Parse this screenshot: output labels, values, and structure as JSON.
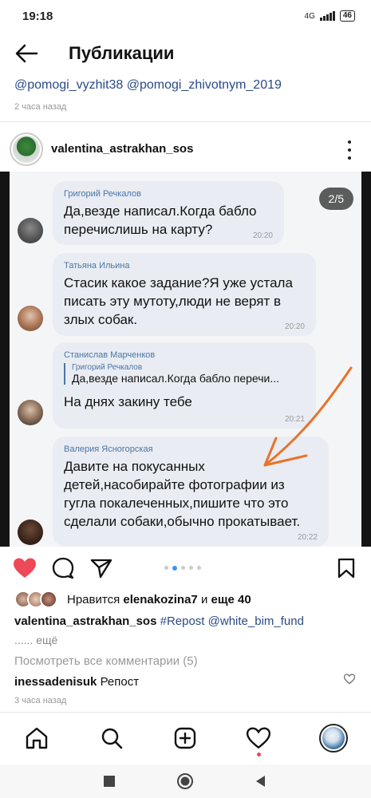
{
  "status_bar": {
    "time": "19:18",
    "network": "4G",
    "battery": "46"
  },
  "header": {
    "title": "Публикации"
  },
  "repost": {
    "tags": "@pomogi_vyzhit38 @pomogi_zhivotnym_2019",
    "time": "2 часа назад"
  },
  "post": {
    "username": "valentina_astrakhan_sos",
    "counter": "2/5",
    "messages": [
      {
        "author": "Григорий Речкалов",
        "text": "Да,везде написал.Когда бабло перечислишь на карту?",
        "time": "20:20"
      },
      {
        "author": "Татьяна Ильина",
        "text": "Стасик какое задание?Я уже устала писать эту мутоту,люди не верят в злых собак.",
        "time": "20:20"
      },
      {
        "author": "Станислав Марченков",
        "quote_author": "Григорий Речкалов",
        "quote_text": "Да,везде написал.Когда бабло перечи...",
        "text": "На днях закину тебе",
        "time": "20:21"
      },
      {
        "author": "Валерия Ясногорская",
        "text": "Давите на покусанных детей,насобирайте фотографии из гугла покалеченных,пишите что это сделали собаки,обычно прокатывает.",
        "time": "20:22"
      }
    ]
  },
  "likes": {
    "prefix": "Нравится",
    "user": "elenakozina7",
    "joiner": "и",
    "rest": "еще 40"
  },
  "caption": {
    "username": "valentina_astrakhan_sos",
    "text": "#Repost @white_bim_fund",
    "more": "...... ещё"
  },
  "view_comments": "Посмотреть все комментарии (5)",
  "comment": {
    "username": "inessadenisuk",
    "text": "Репост"
  },
  "post_time": "3 часа назад",
  "colors": {
    "like": "#ed4956",
    "link": "#2a4a86",
    "dot_active": "#3897f0",
    "arrow": "#e8732a"
  }
}
